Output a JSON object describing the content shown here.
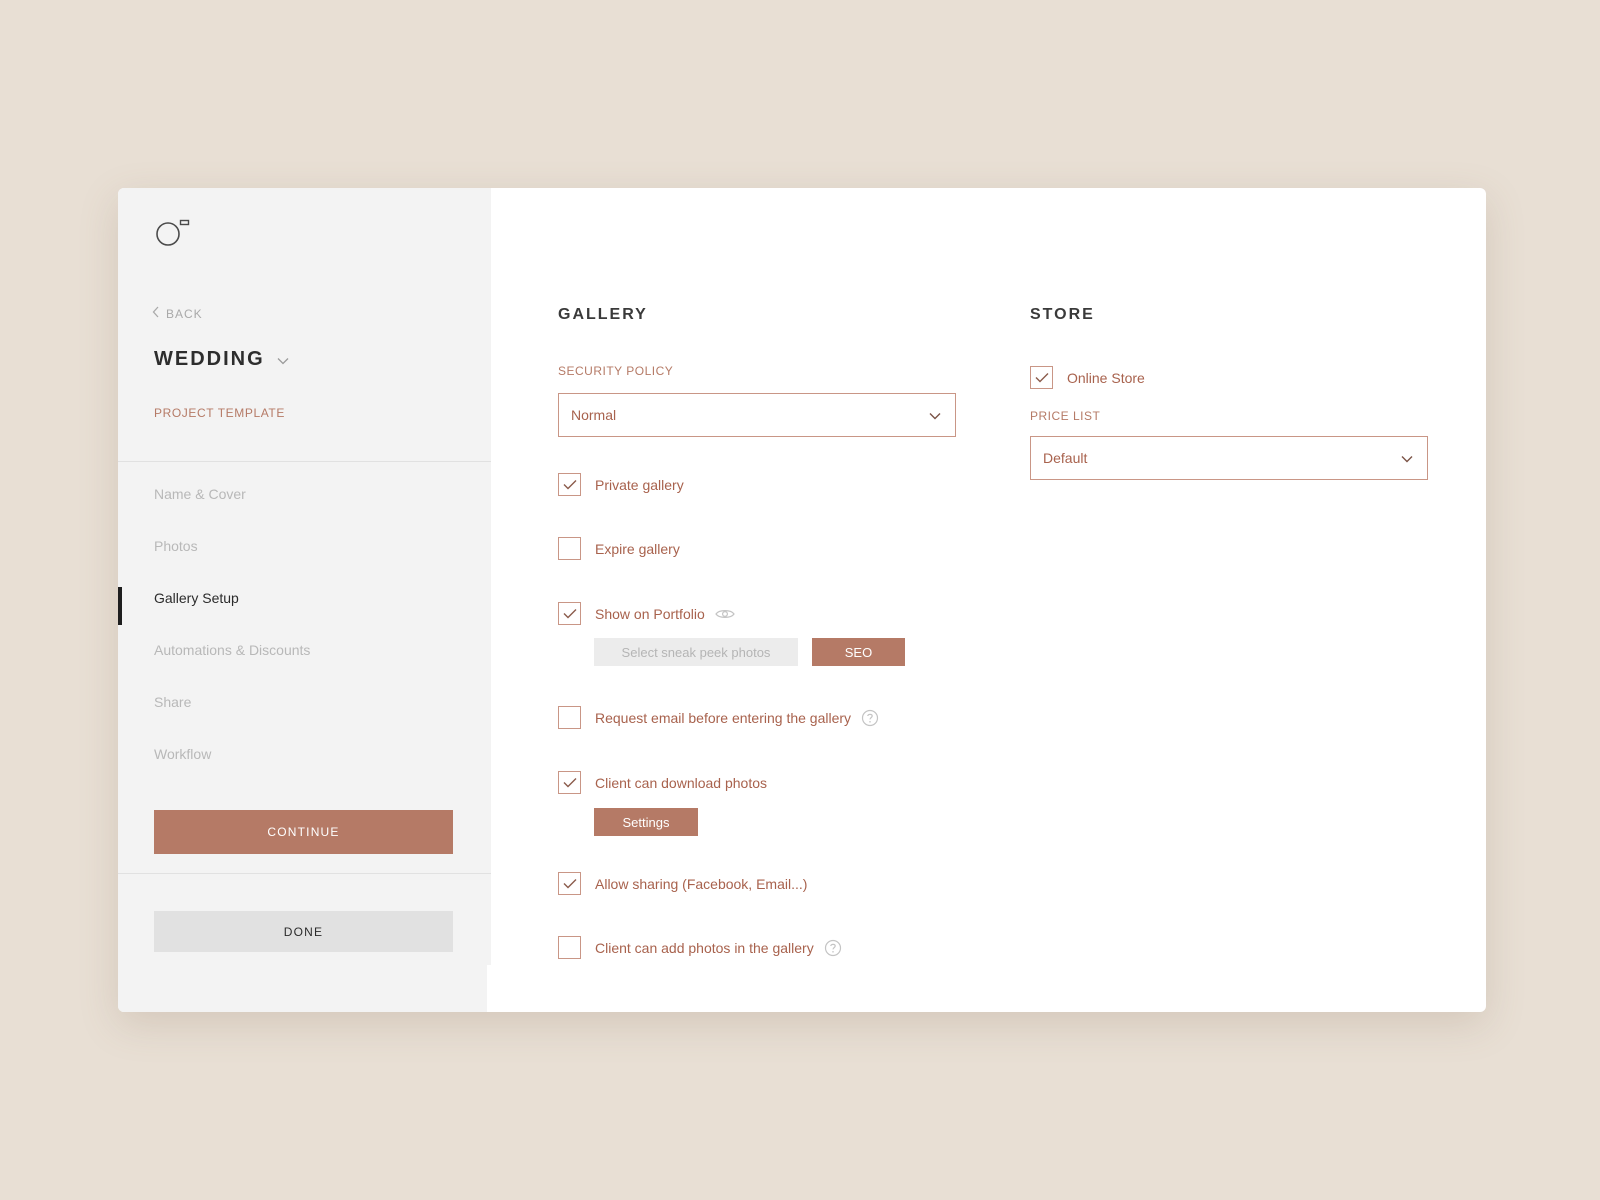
{
  "sidebar": {
    "back_label": "BACK",
    "project_title": "WEDDING",
    "project_subtitle": "PROJECT TEMPLATE",
    "nav": [
      {
        "label": "Name & Cover"
      },
      {
        "label": "Photos"
      },
      {
        "label": "Gallery Setup"
      },
      {
        "label": "Automations & Discounts"
      },
      {
        "label": "Share"
      },
      {
        "label": "Workflow"
      }
    ],
    "active_nav": "Gallery Setup",
    "continue_label": "CONTINUE",
    "done_label": "DONE"
  },
  "gallery": {
    "title": "GALLERY",
    "security_policy_label": "SECURITY POLICY",
    "security_policy_value": "Normal",
    "options": [
      {
        "label": "Private gallery",
        "checked": true
      },
      {
        "label": "Expire gallery",
        "checked": false
      },
      {
        "label": "Show on Portfolio",
        "checked": true
      },
      {
        "label": "Request email before entering the gallery",
        "checked": false
      },
      {
        "label": "Client can download photos",
        "checked": true
      },
      {
        "label": "Allow sharing (Facebook, Email...)",
        "checked": true
      },
      {
        "label": "Client can add photos in the gallery",
        "checked": false
      }
    ],
    "sneak_peek_label": "Select sneak peek photos",
    "seo_label": "SEO",
    "download_settings_label": "Settings"
  },
  "store": {
    "title": "STORE",
    "online_store_label": "Online Store",
    "online_store_checked": true,
    "price_list_label": "PRICE LIST",
    "price_list_value": "Default"
  },
  "colors": {
    "accent": "#b57a66",
    "accent_text": "#a8624d",
    "sidebar_bg": "#f3f3f3",
    "page_bg": "#e8dfd4"
  }
}
